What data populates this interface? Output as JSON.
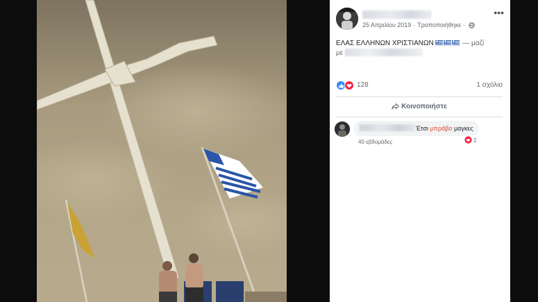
{
  "post": {
    "date": "25 Απριλίου 2019",
    "edited": "Τροποποιήθηκε",
    "text": "ΕΛΑΣ ΕΛΛΗΝΩΝ ΧΡΙΣΤΙΑΝΩΝ",
    "with_label": "— μαζί",
    "with_prefix": "με"
  },
  "reactions": {
    "count": "128",
    "comments": "1 σχόλιο",
    "icons": [
      "like-icon",
      "love-icon"
    ]
  },
  "actions": {
    "share_label": "Κοινοποιήστε"
  },
  "comment": {
    "text_before": "Έτσι",
    "text_highlight": "μπράβο",
    "text_after": "μαγκες",
    "reaction_count": "2",
    "time": "40 εβδομάδες"
  },
  "colors": {
    "flag_blue": "#2a55a8",
    "highlight": "#e0492c",
    "sky": "#a99a7b"
  }
}
